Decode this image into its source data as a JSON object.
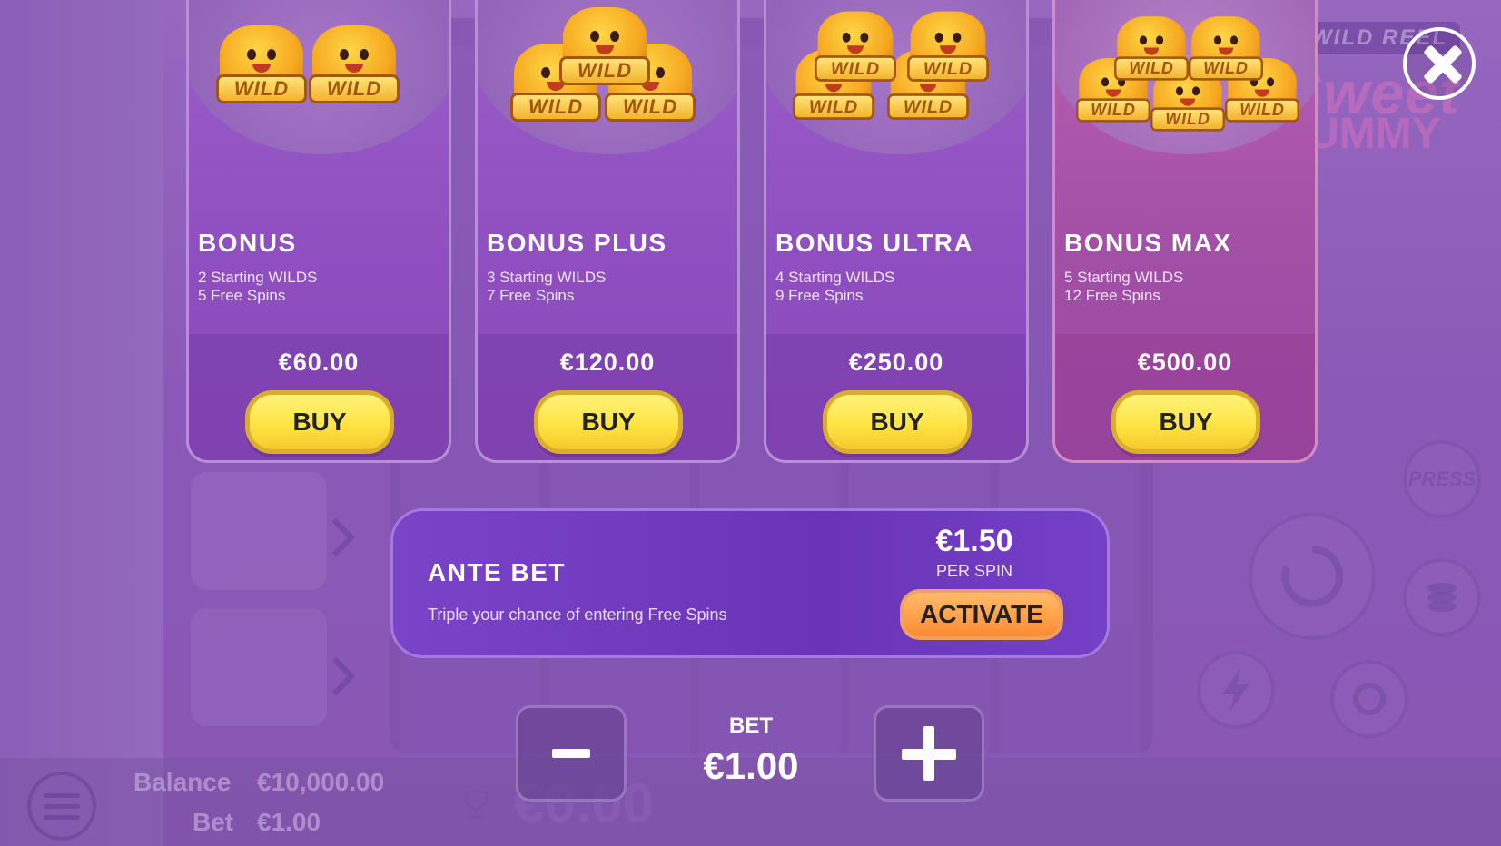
{
  "background": {
    "logo_tag": "WILD REEL",
    "logo_line1": "Sweet",
    "logo_line2": "UMMY",
    "press_label": "PRESS",
    "balance_label": "Balance",
    "balance_value": "€10,000.00",
    "bet_label": "Bet",
    "bet_value": "€1.00",
    "win_value": "€0.00"
  },
  "wild_label": "WILD",
  "cards": [
    {
      "title": "BONUS",
      "line1": "2 Starting WILDS",
      "line2": "5 Free Spins",
      "price": "€60.00",
      "button": "BUY",
      "wilds": 2
    },
    {
      "title": "BONUS PLUS",
      "line1": "3 Starting WILDS",
      "line2": "7 Free Spins",
      "price": "€120.00",
      "button": "BUY",
      "wilds": 3
    },
    {
      "title": "BONUS ULTRA",
      "line1": "4 Starting WILDS",
      "line2": "9 Free Spins",
      "price": "€250.00",
      "button": "BUY",
      "wilds": 4
    },
    {
      "title": "BONUS MAX",
      "line1": "5 Starting WILDS",
      "line2": "12 Free Spins",
      "price": "€500.00",
      "button": "BUY",
      "wilds": 5
    }
  ],
  "ante": {
    "title": "ANTE BET",
    "description": "Triple your chance of entering Free Spins",
    "price": "€1.50",
    "per": "PER SPIN",
    "button": "ACTIVATE"
  },
  "bet": {
    "label": "BET",
    "value": "€1.00"
  },
  "icons": {
    "close": "close-icon",
    "minus": "minus-icon",
    "plus": "plus-icon",
    "menu": "menu-icon",
    "trophy": "trophy-icon"
  },
  "colors": {
    "buy_button": "#ffe444",
    "activate_button": "#ff9f4a",
    "card": "#8f4fc0",
    "card_max": "#a24fa6"
  }
}
